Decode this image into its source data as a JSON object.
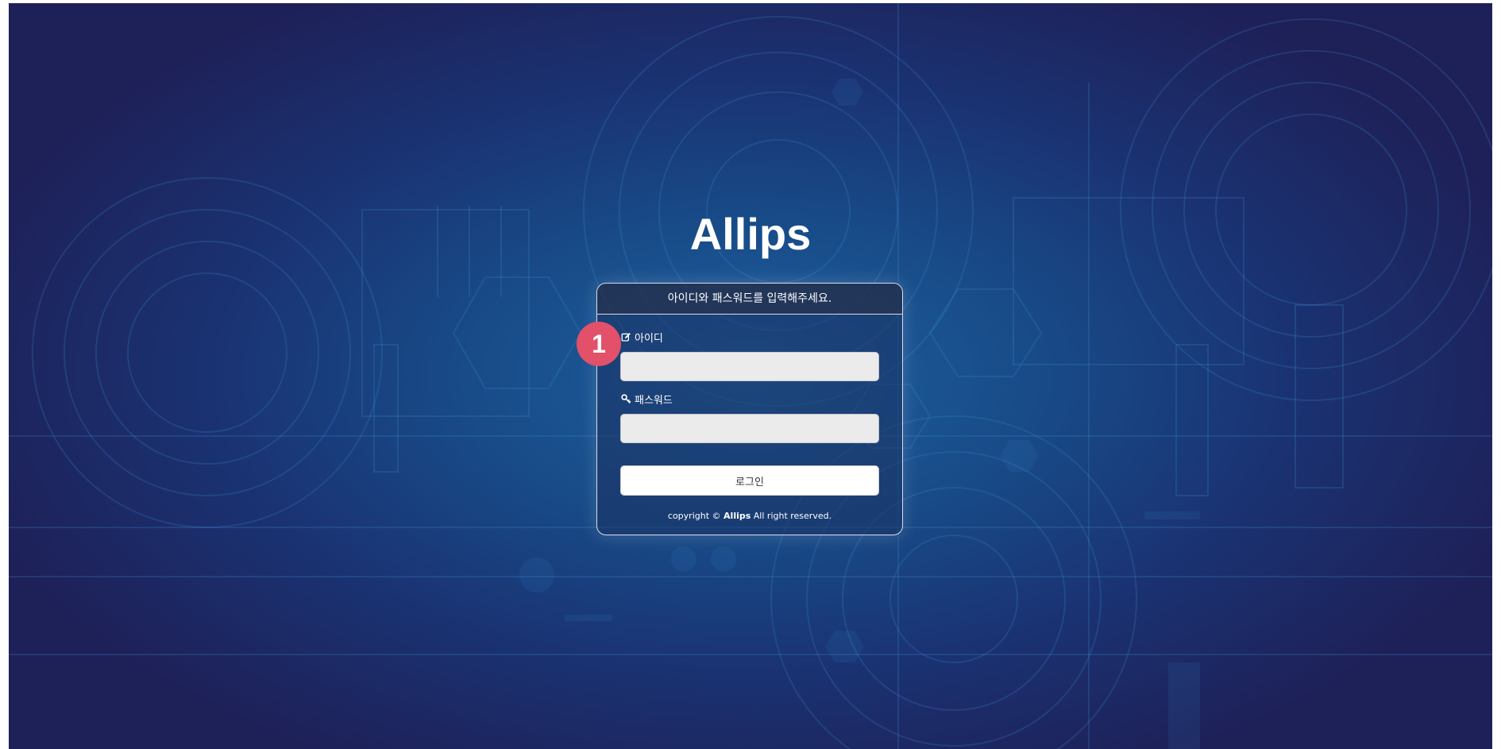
{
  "app": {
    "brand": "Allips"
  },
  "login": {
    "header": "아이디와 패스워드를 입력해주세요.",
    "id_label": "아이디",
    "id_icon": "edit-icon",
    "id_value": "",
    "password_label": "패스워드",
    "password_icon": "key-icon",
    "password_value": "",
    "submit_label": "로그인",
    "copyright_prefix": "copyright ©",
    "copyright_brand": "Allips",
    "copyright_suffix": "All right reserved."
  },
  "annotation": {
    "step_number": "1",
    "color": "#e2506a"
  },
  "colors": {
    "background_dark": "#1e2058",
    "background_center": "#1d5f9e",
    "input_bg": "#ebebeb"
  }
}
